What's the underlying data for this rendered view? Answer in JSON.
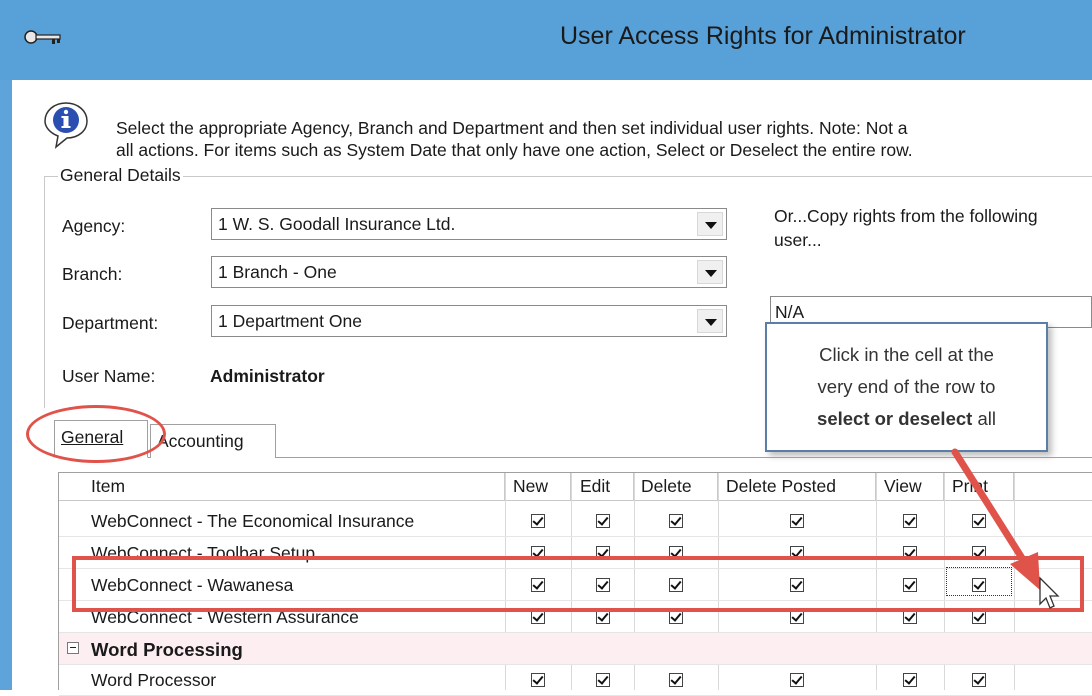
{
  "window": {
    "title": "User Access Rights for Administrator",
    "icon": "keys-icon"
  },
  "info": {
    "icon": "info-icon",
    "line1": "Select the appropriate Agency, Branch and Department and then set individual user rights.  Note:  Not a",
    "line2": "all actions.  For items such as System Date that only have one action, Select or Deselect the entire row."
  },
  "general_details": {
    "legend": "General Details",
    "agency_label": "Agency:",
    "agency_value": "1 W. S. Goodall Insurance Ltd.",
    "branch_label": "Branch:",
    "branch_value": "1 Branch - One",
    "department_label": "Department:",
    "department_value": "1 Department One",
    "username_label": "User Name:",
    "username_value": "Administrator",
    "copy_label_line1": "Or...Copy rights from the following",
    "copy_label_line2": "user...",
    "copy_value": "N/A"
  },
  "callout": {
    "line1": "Click in the cell at the",
    "line2": "very end of the row to",
    "line3_bold": "select or deselect",
    "line3_rest": " all"
  },
  "tabs": [
    {
      "label": "General",
      "active": true
    },
    {
      "label": "Accounting",
      "active": false
    }
  ],
  "grid": {
    "columns": [
      "Item",
      "New",
      "Edit",
      "Delete",
      "Delete Posted",
      "View",
      "Print"
    ],
    "rows": [
      {
        "name": "WebConnect - The Economical Insurance",
        "type": "item",
        "checks": [
          true,
          true,
          true,
          true,
          true,
          true
        ]
      },
      {
        "name": "WebConnect - Toolbar Setup",
        "type": "item",
        "checks": [
          true,
          true,
          true,
          true,
          true,
          true
        ]
      },
      {
        "name": "WebConnect - Wawanesa",
        "type": "item",
        "checks": [
          true,
          true,
          true,
          true,
          true,
          true
        ]
      },
      {
        "name": "WebConnect - Western Assurance",
        "type": "item",
        "checks": [
          true,
          true,
          true,
          true,
          true,
          true
        ]
      },
      {
        "name": "Word Processing",
        "type": "group",
        "checks": []
      },
      {
        "name": "Word Processor",
        "type": "item",
        "checks": [
          true,
          true,
          true,
          true,
          true,
          true
        ]
      }
    ]
  },
  "colors": {
    "titlebar": "#58a0d8",
    "highlight": "#e0534a",
    "group_row": "#fdeef1"
  }
}
